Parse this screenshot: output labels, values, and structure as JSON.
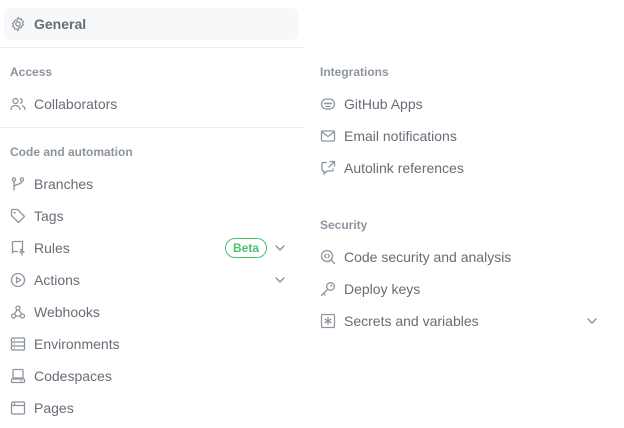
{
  "left": {
    "general": {
      "label": "General",
      "icon": "gear-icon"
    },
    "access": {
      "heading": "Access",
      "items": [
        {
          "label": "Collaborators",
          "icon": "people-icon"
        }
      ]
    },
    "code_automation": {
      "heading": "Code and automation",
      "items": [
        {
          "label": "Branches",
          "icon": "git-branch-icon"
        },
        {
          "label": "Tags",
          "icon": "tag-icon"
        },
        {
          "label": "Rules",
          "icon": "repo-push-icon",
          "badge": "Beta",
          "expandable": true
        },
        {
          "label": "Actions",
          "icon": "play-icon",
          "expandable": true
        },
        {
          "label": "Webhooks",
          "icon": "webhook-icon"
        },
        {
          "label": "Environments",
          "icon": "server-icon"
        },
        {
          "label": "Codespaces",
          "icon": "codespaces-icon"
        },
        {
          "label": "Pages",
          "icon": "browser-icon"
        }
      ]
    }
  },
  "right": {
    "integrations": {
      "heading": "Integrations",
      "items": [
        {
          "label": "GitHub Apps",
          "icon": "hubot-icon"
        },
        {
          "label": "Email notifications",
          "icon": "mail-icon"
        },
        {
          "label": "Autolink references",
          "icon": "cross-reference-icon"
        }
      ]
    },
    "security": {
      "heading": "Security",
      "items": [
        {
          "label": "Code security and analysis",
          "icon": "codescan-icon"
        },
        {
          "label": "Deploy keys",
          "icon": "key-icon"
        },
        {
          "label": "Secrets and variables",
          "icon": "key-asterisk-icon",
          "expandable": true
        }
      ]
    }
  },
  "colors": {
    "text_muted": "#656d76",
    "heading": "#8c959f",
    "selected_bg": "#f6f8fa",
    "beta_green": "#4ac26b"
  }
}
